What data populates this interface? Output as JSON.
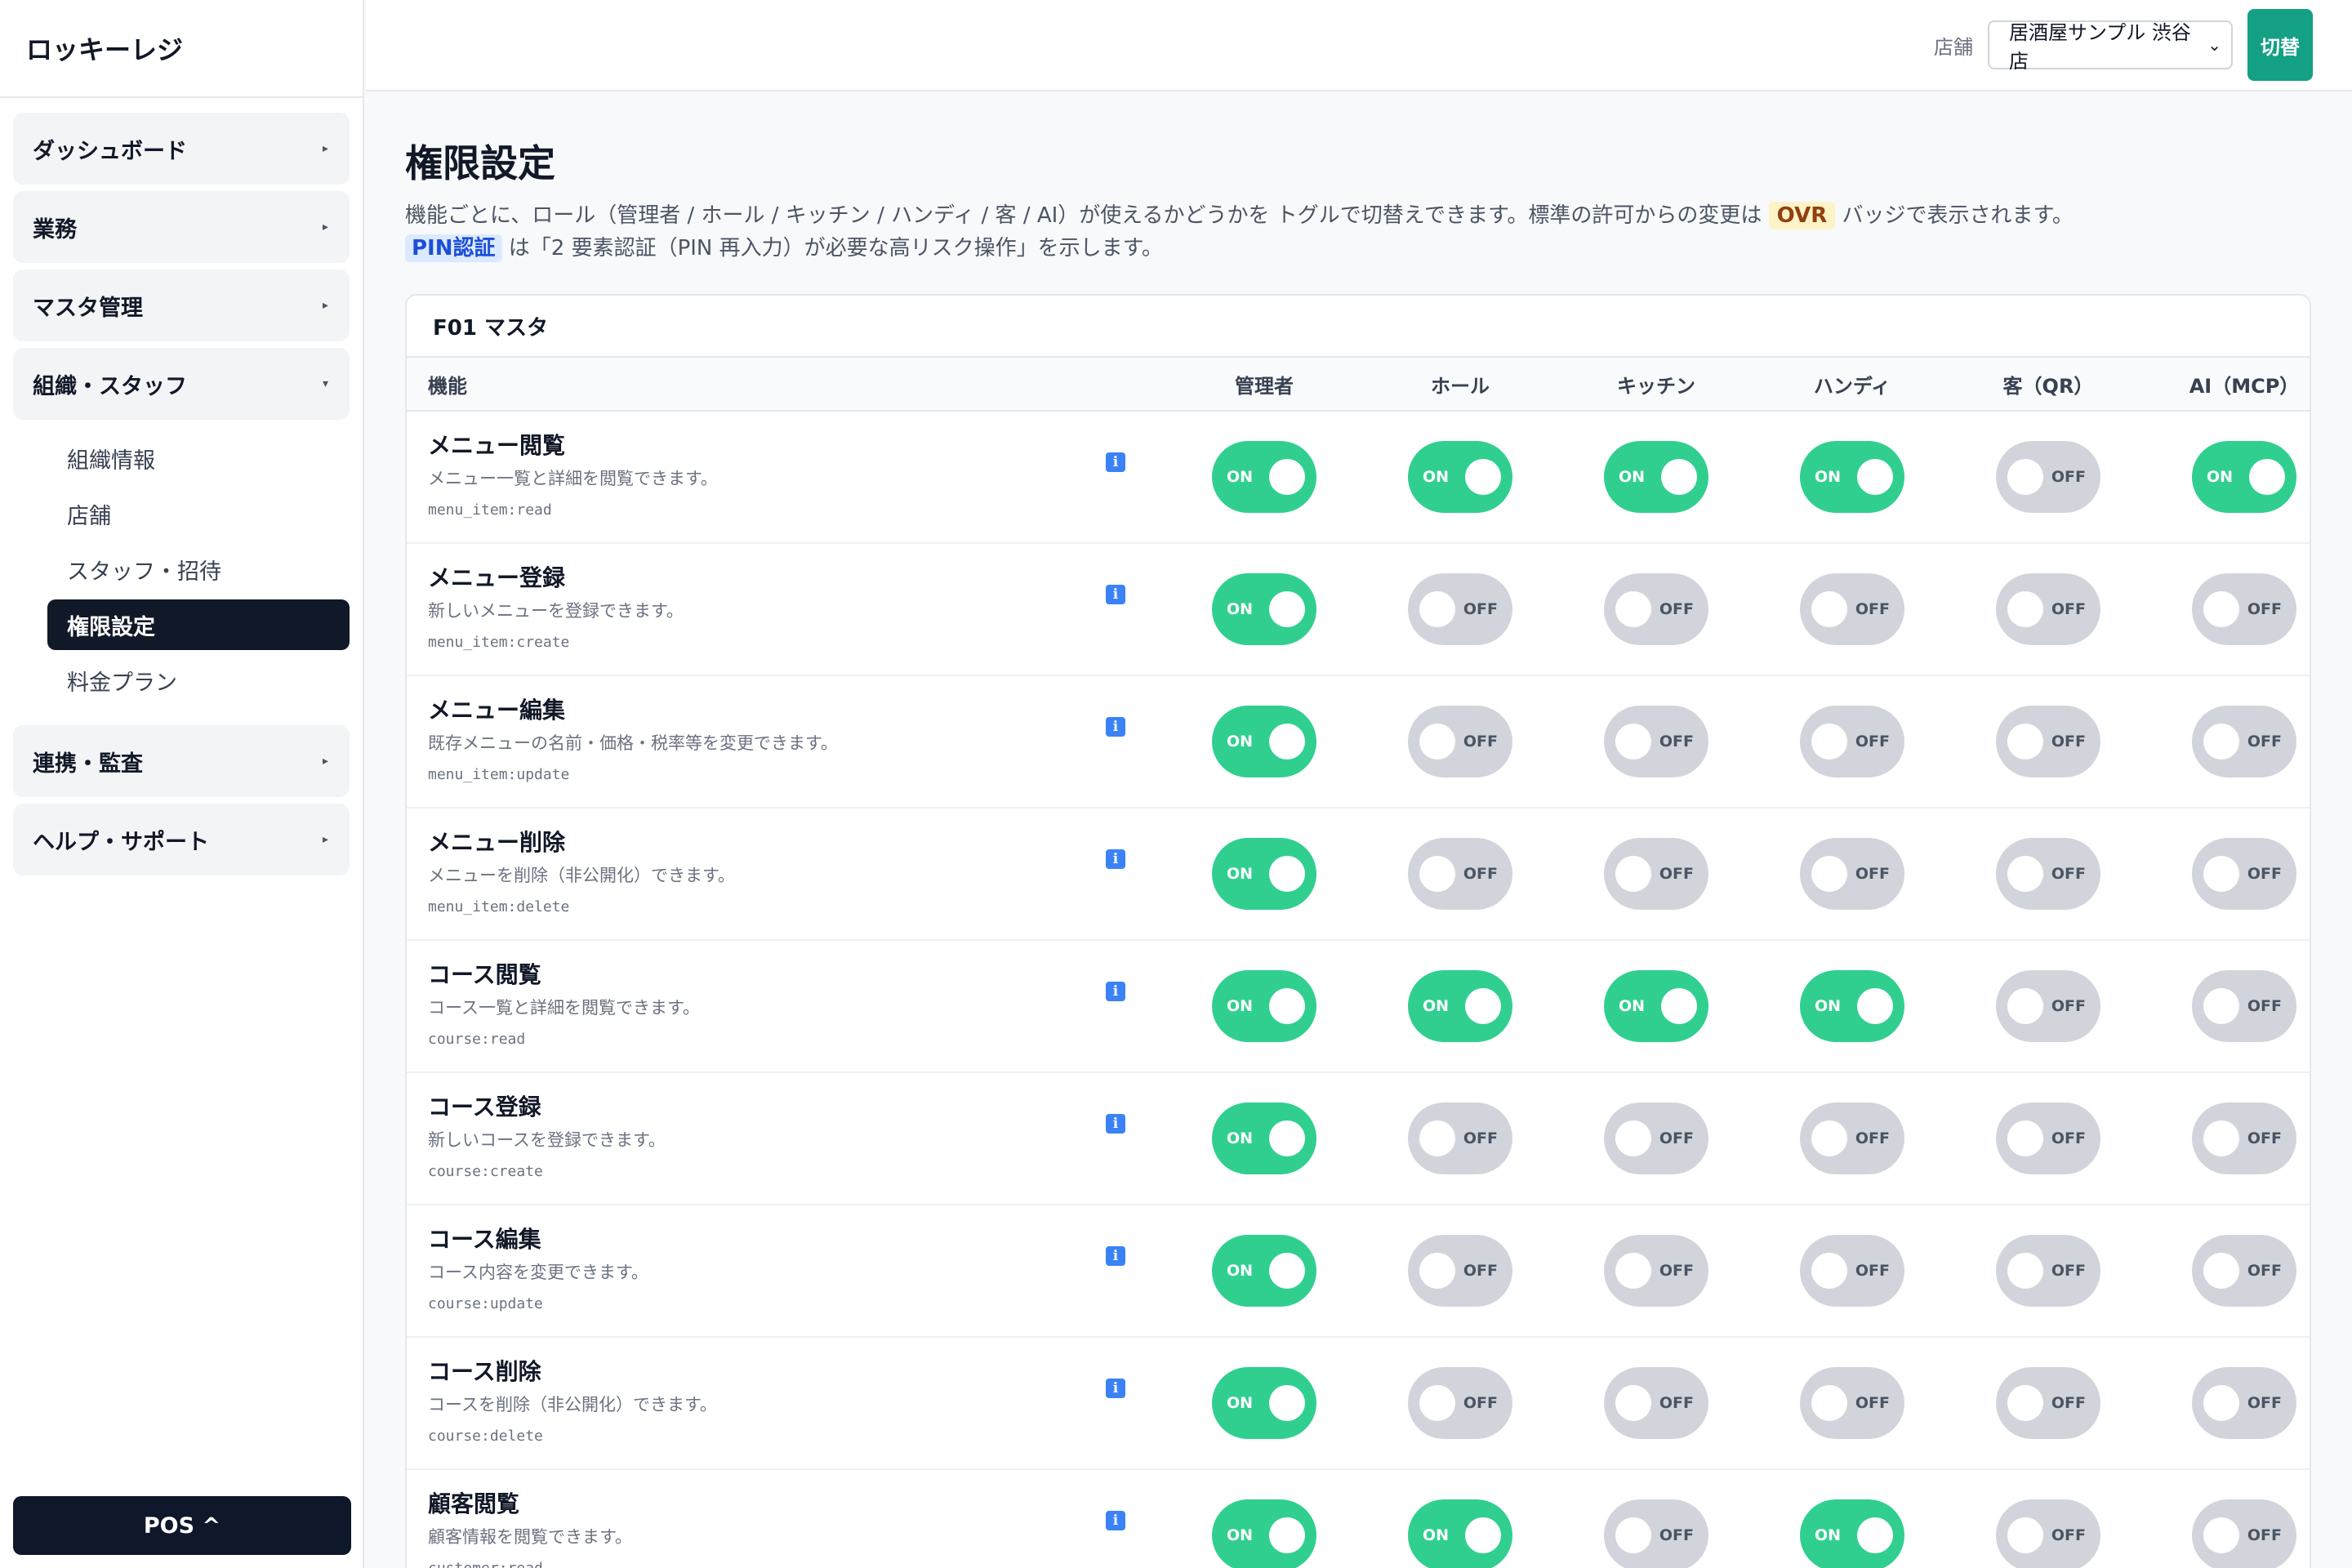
{
  "app": {
    "title": "ロッキーレジ"
  },
  "sidebar": {
    "groups_top": [
      {
        "label": "ダッシュボード",
        "chevron": "▸"
      },
      {
        "label": "業務",
        "chevron": "▸"
      },
      {
        "label": "マスタ管理",
        "chevron": "▸"
      },
      {
        "label": "組織・スタッフ",
        "chevron": "▾"
      }
    ],
    "sub_items": [
      "組織情報",
      "店舗",
      "スタッフ・招待",
      "権限設定",
      "料金プラン"
    ],
    "active_sub": "権限設定",
    "groups_bottom": [
      {
        "label": "連携・監査",
        "chevron": "▸"
      },
      {
        "label": "ヘルプ・サポート",
        "chevron": "▸"
      }
    ],
    "pos_button": "POS ^"
  },
  "topbar": {
    "store_label": "店舗",
    "store_value": "居酒屋サンプル 渋谷店",
    "switch_label": "切替"
  },
  "page": {
    "title": "権限設定",
    "desc_line1_pre": "機能ごとに、ロール（管理者 / ホール / キッチン / ハンディ / 客 / AI）が使えるかどうかを トグルで切替えできます。標準の許可からの変更は ",
    "desc_badge_ovr": "OVR",
    "desc_line1_post": " バッジで表示されます。",
    "desc_badge_pin": "PIN認証",
    "desc_line2_post": " は「2 要素認証（PIN 再入力）が必要な高リスク操作」を示します。"
  },
  "table": {
    "section_title": "F01 マスタ",
    "feature_header": "機能",
    "role_headers": [
      "管理者",
      "ホール",
      "キッチン",
      "ハンディ",
      "客（QR）",
      "AI（MCP）"
    ],
    "on_label": "ON",
    "off_label": "OFF",
    "rows": [
      {
        "name": "メニュー閲覧",
        "desc": "メニュー一覧と詳細を閲覧できます。",
        "code": "menu_item:read",
        "perms": [
          true,
          true,
          true,
          true,
          false,
          true
        ]
      },
      {
        "name": "メニュー登録",
        "desc": "新しいメニューを登録できます。",
        "code": "menu_item:create",
        "perms": [
          true,
          false,
          false,
          false,
          false,
          false
        ]
      },
      {
        "name": "メニュー編集",
        "desc": "既存メニューの名前・価格・税率等を変更できます。",
        "code": "menu_item:update",
        "perms": [
          true,
          false,
          false,
          false,
          false,
          false
        ]
      },
      {
        "name": "メニュー削除",
        "desc": "メニューを削除（非公開化）できます。",
        "code": "menu_item:delete",
        "perms": [
          true,
          false,
          false,
          false,
          false,
          false
        ]
      },
      {
        "name": "コース閲覧",
        "desc": "コース一覧と詳細を閲覧できます。",
        "code": "course:read",
        "perms": [
          true,
          true,
          true,
          true,
          false,
          false
        ]
      },
      {
        "name": "コース登録",
        "desc": "新しいコースを登録できます。",
        "code": "course:create",
        "perms": [
          true,
          false,
          false,
          false,
          false,
          false
        ]
      },
      {
        "name": "コース編集",
        "desc": "コース内容を変更できます。",
        "code": "course:update",
        "perms": [
          true,
          false,
          false,
          false,
          false,
          false
        ]
      },
      {
        "name": "コース削除",
        "desc": "コースを削除（非公開化）できます。",
        "code": "course:delete",
        "perms": [
          true,
          false,
          false,
          false,
          false,
          false
        ]
      },
      {
        "name": "顧客閲覧",
        "desc": "顧客情報を閲覧できます。",
        "code": "customer:read",
        "perms": [
          true,
          true,
          false,
          true,
          false,
          false
        ]
      }
    ]
  },
  "colors": {
    "toggle_on": "#31cf8f",
    "toggle_off": "#d1d5db",
    "sidebar_active": "#111827",
    "switch_button": "#14a085"
  },
  "icons": {
    "info": "info-icon"
  }
}
